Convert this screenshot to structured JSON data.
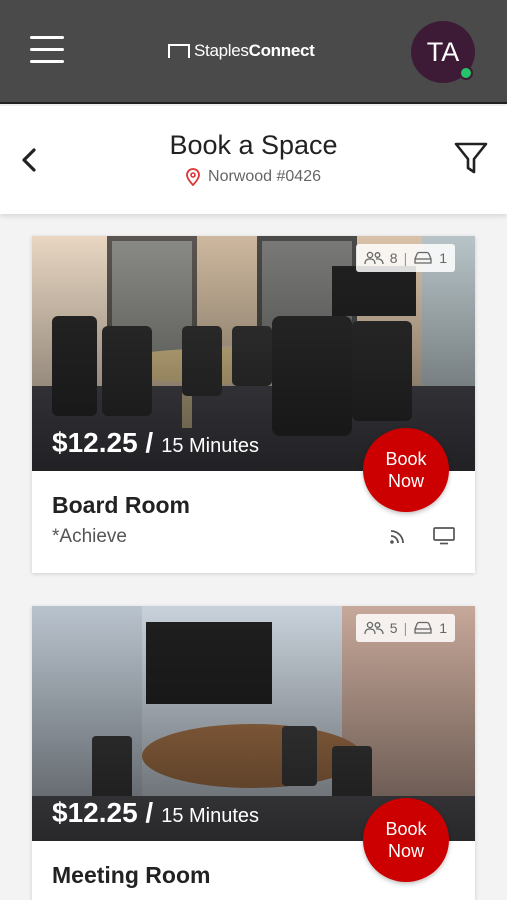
{
  "header": {
    "logo_part1": "Staples",
    "logo_part2": "Connect",
    "avatar_initials": "TA",
    "avatar_color": "#3d1b36",
    "status_color": "#26c46a"
  },
  "subheader": {
    "title": "Book a Space",
    "location": "Norwood #0426"
  },
  "rooms": [
    {
      "capacity": "8",
      "parking": "1",
      "price": "$12.25 /",
      "price_unit": "15 Minutes",
      "book_line1": "Book",
      "book_line2": "Now",
      "name": "Board Room",
      "tag": "*Achieve"
    },
    {
      "capacity": "5",
      "parking": "1",
      "price": "$12.25 /",
      "price_unit": "15 Minutes",
      "book_line1": "Book",
      "book_line2": "Now",
      "name": "Meeting Room",
      "tag": ""
    }
  ],
  "colors": {
    "topbar": "#4a4a4a",
    "book_button": "#cc0000"
  }
}
